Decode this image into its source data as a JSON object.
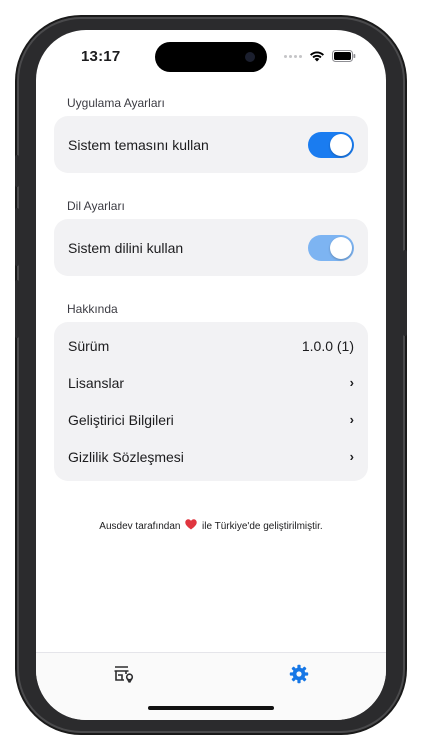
{
  "status": {
    "time": "13:17"
  },
  "sections": {
    "app": {
      "title": "Uygulama Ayarları",
      "toggle_label": "Sistem temasını kullan",
      "toggle_on": true
    },
    "language": {
      "title": "Dil Ayarları",
      "toggle_label": "Sistem dilini kullan",
      "toggle_on": true
    },
    "about": {
      "title": "Hakkında",
      "version_label": "Sürüm",
      "version_value": "1.0.0 (1)",
      "items": [
        {
          "label": "Lisanslar"
        },
        {
          "label": "Geliştirici Bilgileri"
        },
        {
          "label": "Gizlilik Sözleşmesi"
        }
      ]
    }
  },
  "footer": {
    "before": "Ausdev tarafından",
    "after": "ile Türkiye'de geliştirilmiştir."
  },
  "tabbar": {
    "tabs": [
      {
        "icon": "store-location-icon",
        "active": false
      },
      {
        "icon": "gear-icon",
        "active": true
      }
    ]
  },
  "colors": {
    "accent": "#1677e6",
    "toggle_on": "#1a7cf0",
    "toggle_on_dim": "#7db4f2",
    "card_bg": "#f2f2f4",
    "heart": "#e0353f"
  }
}
